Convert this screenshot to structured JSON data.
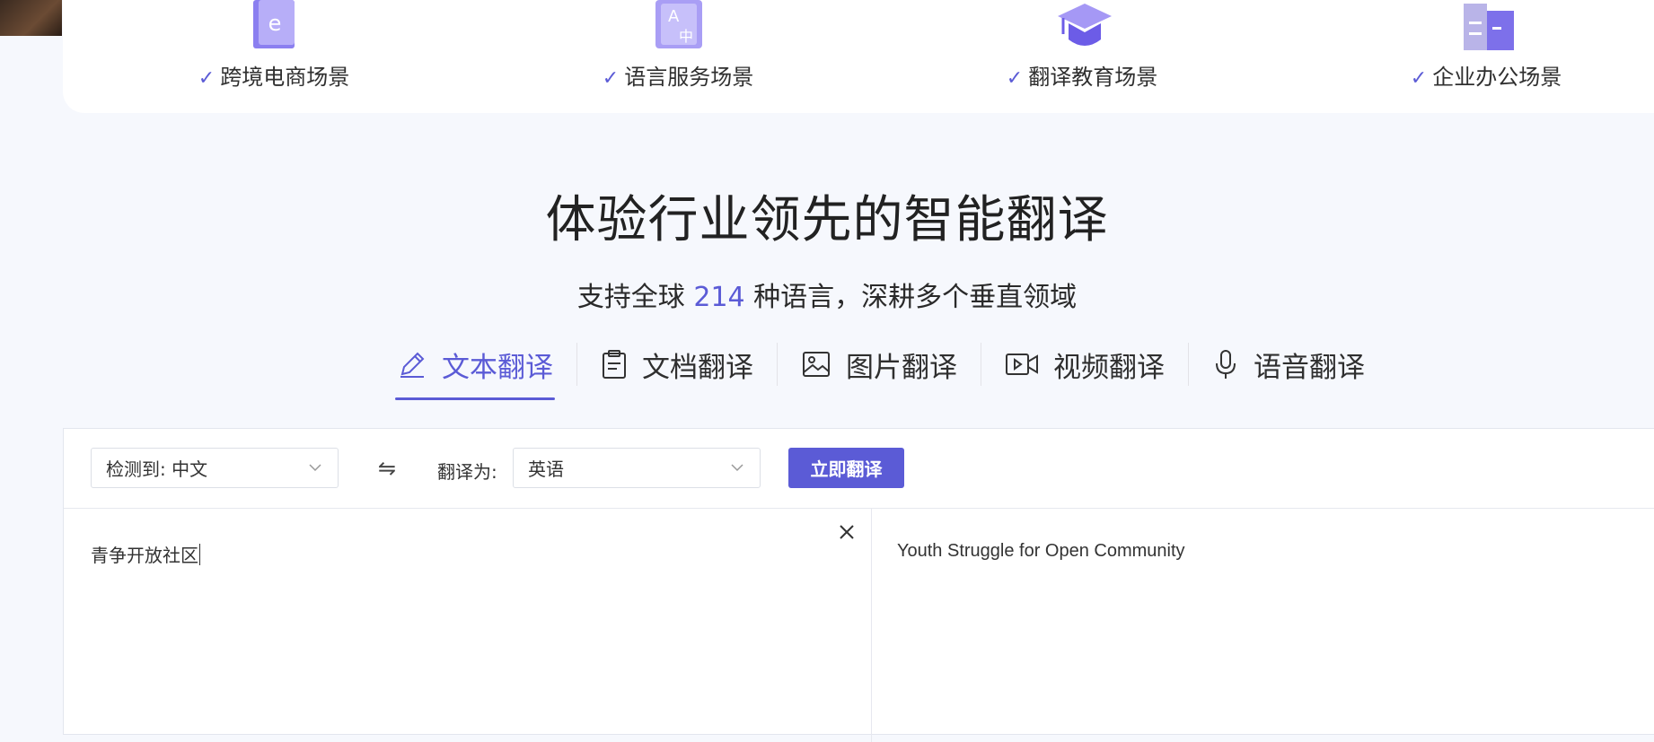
{
  "scenarios": [
    {
      "label": "跨境电商场景",
      "icon": "shopping-bag-icon"
    },
    {
      "label": "语言服务场景",
      "icon": "translate-language-icon"
    },
    {
      "label": "翻译教育场景",
      "icon": "graduation-cap-icon"
    },
    {
      "label": "企业办公场景",
      "icon": "office-building-icon"
    }
  ],
  "hero": {
    "title": "体验行业领先的智能翻译",
    "subtitle_before": "支持全球 ",
    "subtitle_number": "214",
    "subtitle_after": " 种语言，深耕多个垂直领域"
  },
  "tabs": [
    {
      "label": "文本翻译",
      "icon": "pencil-icon",
      "active": true
    },
    {
      "label": "文档翻译",
      "icon": "document-icon",
      "active": false
    },
    {
      "label": "图片翻译",
      "icon": "image-icon",
      "active": false
    },
    {
      "label": "视频翻译",
      "icon": "video-icon",
      "active": false
    },
    {
      "label": "语音翻译",
      "icon": "microphone-icon",
      "active": false
    }
  ],
  "translator": {
    "source_select": "检测到: 中文",
    "swap_symbol": "⇋",
    "target_label": "翻译为:",
    "target_select": "英语",
    "translate_button": "立即翻译",
    "source_text": "青争开放社区",
    "target_text": "Youth Struggle for Open Community"
  },
  "colors": {
    "accent": "#5b5bd6",
    "background": "#f6f8fd"
  }
}
